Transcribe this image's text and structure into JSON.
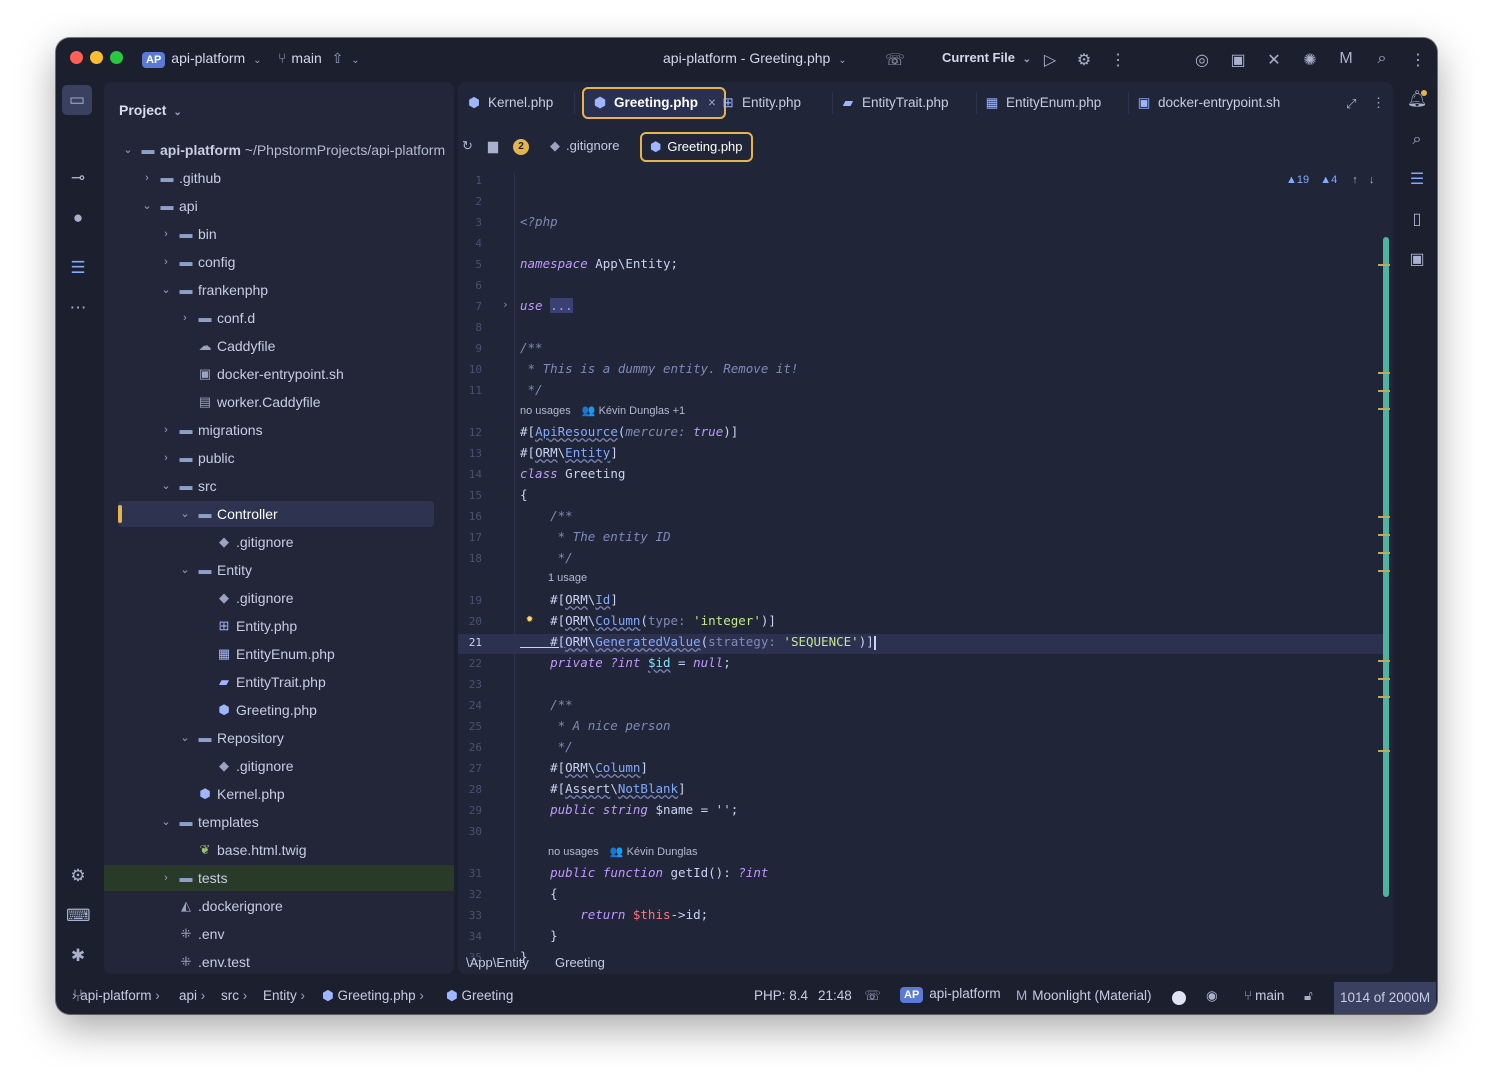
{
  "titlebar": {
    "project_badge": "AP",
    "project_name": "api-platform",
    "branch": "main",
    "window_title": "api-platform - Greeting.php",
    "run_config": "Current File"
  },
  "project_panel": {
    "title": "Project",
    "root_name": "api-platform",
    "root_path": "~/PhpstormProjects/api-platform",
    "items": [
      {
        "label": ".github",
        "depth": 1,
        "expand": "collapsed",
        "icon": "folder-icon"
      },
      {
        "label": "api",
        "depth": 1,
        "expand": "expanded",
        "icon": "folder-icon"
      },
      {
        "label": "bin",
        "depth": 2,
        "expand": "collapsed",
        "icon": "folder-icon"
      },
      {
        "label": "config",
        "depth": 2,
        "expand": "collapsed",
        "icon": "folder-icon"
      },
      {
        "label": "frankenphp",
        "depth": 2,
        "expand": "expanded",
        "icon": "folder-icon"
      },
      {
        "label": "conf.d",
        "depth": 3,
        "expand": "collapsed",
        "icon": "folder-icon"
      },
      {
        "label": "Caddyfile",
        "depth": 3,
        "expand": "none",
        "icon": "caddy-icon"
      },
      {
        "label": "docker-entrypoint.sh",
        "depth": 3,
        "expand": "none",
        "icon": "terminal-file-icon"
      },
      {
        "label": "worker.Caddyfile",
        "depth": 3,
        "expand": "none",
        "icon": "text-file-icon"
      },
      {
        "label": "migrations",
        "depth": 2,
        "expand": "collapsed",
        "icon": "folder-icon"
      },
      {
        "label": "public",
        "depth": 2,
        "expand": "collapsed",
        "icon": "folder-icon"
      },
      {
        "label": "src",
        "depth": 2,
        "expand": "expanded",
        "icon": "folder-icon"
      },
      {
        "label": "Controller",
        "depth": 3,
        "expand": "expanded",
        "icon": "folder-icon",
        "selected": true
      },
      {
        "label": ".gitignore",
        "depth": 4,
        "expand": "none",
        "icon": "git-icon"
      },
      {
        "label": "Entity",
        "depth": 3,
        "expand": "expanded",
        "icon": "folder-icon"
      },
      {
        "label": ".gitignore",
        "depth": 4,
        "expand": "none",
        "icon": "git-icon"
      },
      {
        "label": "Entity.php",
        "depth": 4,
        "expand": "none",
        "icon": "class-icon"
      },
      {
        "label": "EntityEnum.php",
        "depth": 4,
        "expand": "none",
        "icon": "enum-icon"
      },
      {
        "label": "EntityTrait.php",
        "depth": 4,
        "expand": "none",
        "icon": "trait-icon"
      },
      {
        "label": "Greeting.php",
        "depth": 4,
        "expand": "none",
        "icon": "php-icon"
      },
      {
        "label": "Repository",
        "depth": 3,
        "expand": "expanded",
        "icon": "folder-icon"
      },
      {
        "label": ".gitignore",
        "depth": 4,
        "expand": "none",
        "icon": "git-icon"
      },
      {
        "label": "Kernel.php",
        "depth": 3,
        "expand": "none",
        "icon": "php-icon"
      },
      {
        "label": "templates",
        "depth": 2,
        "expand": "expanded",
        "icon": "folder-icon"
      },
      {
        "label": "base.html.twig",
        "depth": 3,
        "expand": "none",
        "icon": "twig-icon"
      },
      {
        "label": "tests",
        "depth": 2,
        "expand": "collapsed",
        "icon": "folder-icon",
        "highlight": true
      },
      {
        "label": ".dockerignore",
        "depth": 2,
        "expand": "none",
        "icon": "docker-icon"
      },
      {
        "label": ".env",
        "depth": 2,
        "expand": "none",
        "icon": "env-icon"
      },
      {
        "label": ".env.test",
        "depth": 2,
        "expand": "none",
        "icon": "env-icon"
      }
    ]
  },
  "tabs": [
    {
      "label": "Kernel.php",
      "icon": "php-icon"
    },
    {
      "label": "Greeting.php",
      "icon": "php-icon",
      "active": true
    },
    {
      "label": "Entity.php",
      "icon": "class-icon"
    },
    {
      "label": "EntityTrait.php",
      "icon": "trait-icon"
    },
    {
      "label": "EntityEnum.php",
      "icon": "enum-icon"
    },
    {
      "label": "docker-entrypoint.sh",
      "icon": "terminal-file-icon"
    }
  ],
  "editor_crumbs": {
    "count": "2",
    "item1": ".gitignore",
    "item2": "Greeting.php"
  },
  "inspections": {
    "warnings": "19",
    "weak_warnings": "4"
  },
  "hints": {
    "h11_usages": "no usages",
    "h11_author": "Kévin Dunglas +1",
    "h18_usages": "1 usage",
    "h30_usages": "no usages",
    "h30_author": "Kévin Dunglas"
  },
  "code": {
    "l1": "<?php",
    "l3a": "namespace",
    "l3b": " App\\Entity;",
    "l5a": "use",
    "l5b": "...",
    "l9": "/**",
    "l10": " * This is a dummy entity. Remove it!",
    "l11": " */",
    "l12a": "#[",
    "l12b": "ApiResource",
    "l12c": "(",
    "l12d": "mercure: ",
    "l12e": "true",
    "l12f": ")]",
    "l13a": "#[",
    "l13b": "ORM",
    "l13c": "\\",
    "l13d": "Entity",
    "l13e": "]",
    "l14a": "class",
    "l14b": " Greeting",
    "l15": "{",
    "l16": "    /**",
    "l17": "     * The entity ID",
    "l18": "     */",
    "l19a": "    #[",
    "l19b": "ORM",
    "l19c": "\\",
    "l19d": "Id",
    "l19e": "]",
    "l20a": "    #[",
    "l20b": "ORM",
    "l20c": "\\",
    "l20d": "Column",
    "l20e": "(",
    "l20f": "type: ",
    "l20g": "'integer'",
    "l20h": ")]",
    "l21a": "    #[",
    "l21b": "ORM",
    "l21c": "\\",
    "l21d": "GeneratedValue",
    "l21e": "(",
    "l21f": "strategy: ",
    "l21g": "'SEQUENCE'",
    "l21h": ")]",
    "l22a": "    private",
    "l22b": " ?int ",
    "l22c": "$id",
    "l22d": " = ",
    "l22e": "null",
    "l22f": ";",
    "l24": "    /**",
    "l25": "     * A nice person",
    "l26": "     */",
    "l27a": "    #[",
    "l27b": "ORM",
    "l27c": "\\",
    "l27d": "Column",
    "l27e": "]",
    "l28a": "    #[",
    "l28b": "Assert",
    "l28c": "\\",
    "l28d": "NotBlank",
    "l28e": "]",
    "l29a": "    public",
    "l29b": " string",
    "l29c": " $name = '';",
    "l31a": "    public",
    "l31b": " function",
    "l31c": " getId(): ",
    "l31d": "?int",
    "l32": "    {",
    "l33a": "        return",
    "l33b": " $this",
    "l33c": "->id;",
    "l34": "    }",
    "l35": "}"
  },
  "editor_status": {
    "namespace": "\\App\\Entity",
    "class": "Greeting"
  },
  "statusbar": {
    "crumbs": [
      "api-platform",
      "api",
      "src",
      "Entity",
      "Greeting.php",
      "Greeting"
    ],
    "php_version": "PHP: 8.4",
    "position": "21:48",
    "project_badge": "AP",
    "project": "api-platform",
    "theme": "Moonlight (Material)",
    "branch": "main",
    "memory": "1014 of 2000M"
  },
  "colors": {
    "window_bg": "#1c1f2e",
    "panel_bg": "#222638",
    "active_tab_border": "#e5b54c",
    "accent_blue": "#82aaff",
    "scroll_green": "#4fb3a0"
  }
}
